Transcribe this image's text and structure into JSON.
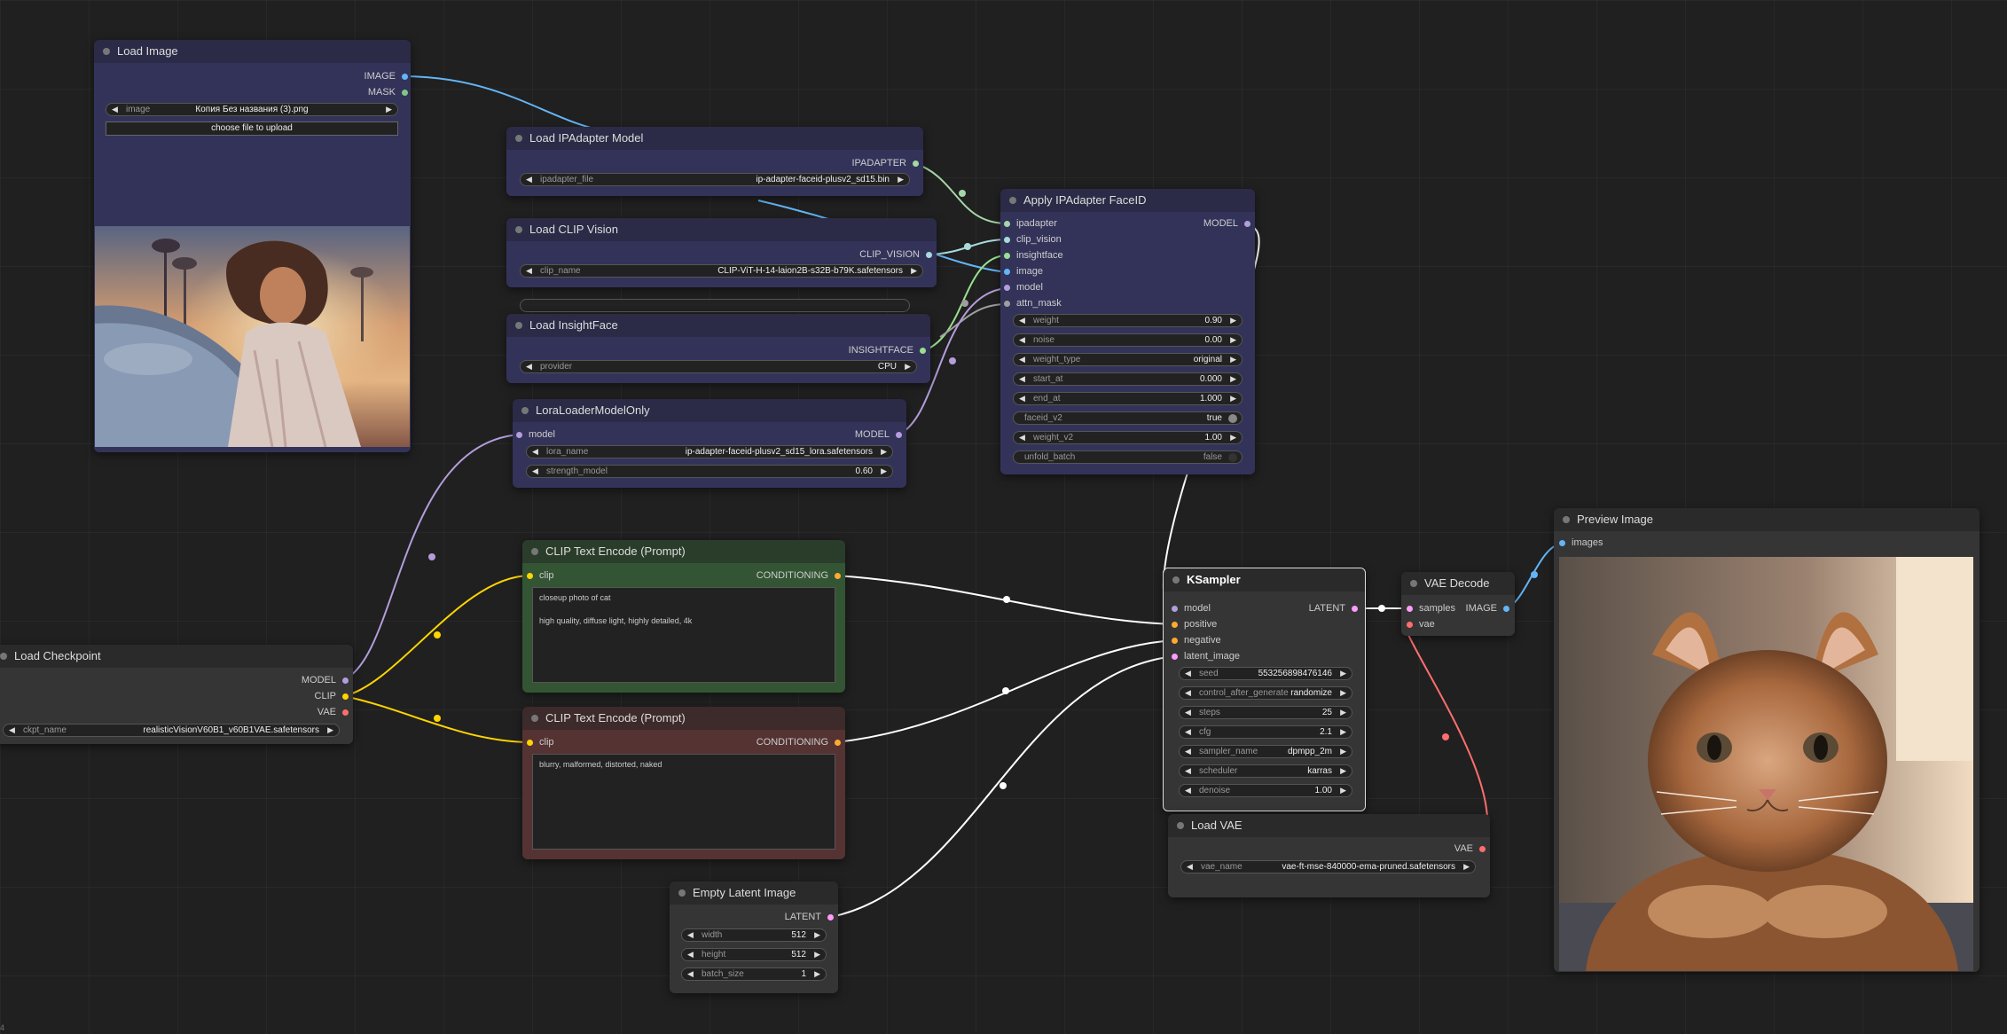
{
  "nodes": {
    "load_image": {
      "title": "Load Image",
      "outputs": [
        "IMAGE",
        "MASK"
      ],
      "image_widget": {
        "label": "image",
        "value": "Копия Без названия (3).png"
      },
      "upload_button": "choose file to upload"
    },
    "load_ipadapter_model": {
      "title": "Load IPAdapter Model",
      "output": "IPADAPTER",
      "widget": {
        "label": "ipadapter_file",
        "value": "ip-adapter-faceid-plusv2_sd15.bin"
      }
    },
    "load_clip_vision": {
      "title": "Load CLIP Vision",
      "output": "CLIP_VISION",
      "widget": {
        "label": "clip_name",
        "value": "CLIP-ViT-H-14-laion2B-s32B-b79K.safetensors"
      }
    },
    "load_insightface": {
      "title": "Load InsightFace",
      "output": "INSIGHTFACE",
      "widget": {
        "label": "provider",
        "value": "CPU"
      }
    },
    "lora_loader": {
      "title": "LoraLoaderModelOnly",
      "input": "model",
      "output": "MODEL",
      "widgets": [
        {
          "label": "lora_name",
          "value": "ip-adapter-faceid-plusv2_sd15_lora.safetensors"
        },
        {
          "label": "strength_model",
          "value": "0.60"
        }
      ]
    },
    "apply_ipadapter": {
      "title": "Apply IPAdapter FaceID",
      "inputs": [
        "ipadapter",
        "clip_vision",
        "insightface",
        "image",
        "model",
        "attn_mask"
      ],
      "output": "MODEL",
      "widgets": [
        {
          "label": "weight",
          "value": "0.90"
        },
        {
          "label": "noise",
          "value": "0.00"
        },
        {
          "label": "weight_type",
          "value": "original"
        },
        {
          "label": "start_at",
          "value": "0.000"
        },
        {
          "label": "end_at",
          "value": "1.000"
        },
        {
          "label": "faceid_v2",
          "value": "true"
        },
        {
          "label": "weight_v2",
          "value": "1.00"
        },
        {
          "label": "unfold_batch",
          "value": "false"
        }
      ]
    },
    "load_checkpoint": {
      "title": "Load Checkpoint",
      "outputs": [
        "MODEL",
        "CLIP",
        "VAE"
      ],
      "widget": {
        "label": "ckpt_name",
        "value": "realisticVisionV60B1_v60B1VAE.safetensors"
      }
    },
    "clip_positive": {
      "title": "CLIP Text Encode (Prompt)",
      "input": "clip",
      "output": "CONDITIONING",
      "text": "closeup photo of cat\n\nhigh quality, diffuse light, highly detailed, 4k"
    },
    "clip_negative": {
      "title": "CLIP Text Encode (Prompt)",
      "input": "clip",
      "output": "CONDITIONING",
      "text": "blurry, malformed, distorted, naked"
    },
    "empty_latent": {
      "title": "Empty Latent Image",
      "output": "LATENT",
      "widgets": [
        {
          "label": "width",
          "value": "512"
        },
        {
          "label": "height",
          "value": "512"
        },
        {
          "label": "batch_size",
          "value": "1"
        }
      ]
    },
    "ksampler": {
      "title": "KSampler",
      "inputs": [
        "model",
        "positive",
        "negative",
        "latent_image"
      ],
      "output": "LATENT",
      "widgets": [
        {
          "label": "seed",
          "value": "553256898476146"
        },
        {
          "label": "control_after_generate",
          "value": "randomize"
        },
        {
          "label": "steps",
          "value": "25"
        },
        {
          "label": "cfg",
          "value": "2.1"
        },
        {
          "label": "sampler_name",
          "value": "dpmpp_2m"
        },
        {
          "label": "scheduler",
          "value": "karras"
        },
        {
          "label": "denoise",
          "value": "1.00"
        }
      ]
    },
    "vae_decode": {
      "title": "VAE Decode",
      "inputs": [
        "samples",
        "vae"
      ],
      "output": "IMAGE"
    },
    "load_vae": {
      "title": "Load VAE",
      "output": "VAE",
      "widget": {
        "label": "vae_name",
        "value": "vae-ft-mse-840000-ema-pruned.safetensors"
      }
    },
    "preview_image": {
      "title": "Preview Image",
      "input": "images"
    }
  },
  "colors": {
    "model": "#b39ddb",
    "clip": "#ffd500",
    "vae": "#ff6e6e",
    "image": "#64b5f6",
    "conditioning": "#ffa931",
    "latent": "#ff9cf9",
    "ipadapter": "#a5d6a7",
    "clip_vision": "#a8dadc",
    "insightface": "#98e08e",
    "mask": "#81c784",
    "attn_mask": "#9e9e9e",
    "link_default": "#ffffff"
  },
  "corner_mark": "4"
}
